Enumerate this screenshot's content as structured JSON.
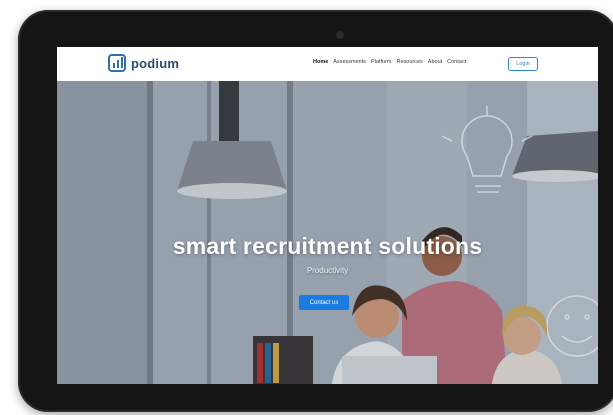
{
  "brand": {
    "name": "podium"
  },
  "nav": {
    "items": [
      "Home",
      "Assessments",
      "Platform",
      "Resources",
      "About",
      "Contact"
    ],
    "active": "Home",
    "login_label": "Login"
  },
  "hero": {
    "headline": "smart recruitment solutions",
    "subline": "Productivity",
    "cta_label": "Contact us"
  },
  "colors": {
    "brand": "#2f6fae",
    "cta": "#1a7be0",
    "frame": "#151515"
  },
  "icons": [
    "podium-logo-icon"
  ]
}
